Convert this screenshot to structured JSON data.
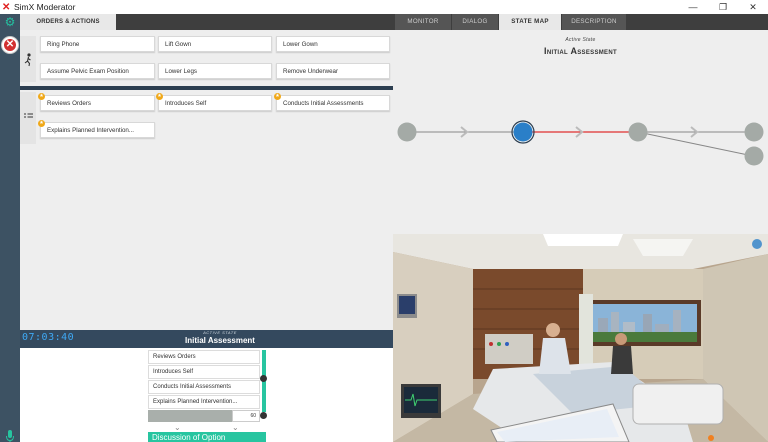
{
  "window": {
    "title": "SimX Moderator",
    "controls": [
      "—",
      "❐",
      "✕"
    ]
  },
  "left_panel": {
    "tab_label": "ORDERS & ACTIONS",
    "actions_row1": [
      "Ring Phone",
      "Lift Gown",
      "Lower Gown"
    ],
    "actions_row2": [
      "Assume Pelvic Exam Position",
      "Lower Legs",
      "Remove Underwear"
    ],
    "checklist_row1": [
      "Reviews Orders",
      "Introduces Self",
      "Conducts Initial Assessments"
    ],
    "checklist_row2": [
      "Explains Planned Intervention..."
    ],
    "star_glyph": "★"
  },
  "bottom_panel": {
    "timer": "07:03:40",
    "active_state_label": "ACTIVE STATE",
    "active_state_title": "Initial Assessment",
    "list": [
      "Reviews Orders",
      "Introduces Self",
      "Conducts Initial Assessments",
      "Explains Planned Intervention..."
    ],
    "slider_value": "60",
    "discussion_label": "Discussion of Option"
  },
  "right_panel": {
    "tabs": [
      "MONITOR",
      "DIALOG",
      "STATE MAP",
      "DESCRIPTION"
    ],
    "active_tab": "STATE MAP",
    "state_map": {
      "active_label": "Active State",
      "title": "Initial Assessment"
    }
  },
  "colors": {
    "rail": "#3d5263",
    "accent_teal": "#27c5a0",
    "active_node": "#2a7fc8",
    "active_edge": "#e03030",
    "star": "#f0a818"
  },
  "icons": {
    "settings": "gear-icon",
    "close": "close-icon",
    "actions_section": "walking-person-icon",
    "checklist_section": "checklist-icon",
    "mic": "microphone-icon"
  }
}
